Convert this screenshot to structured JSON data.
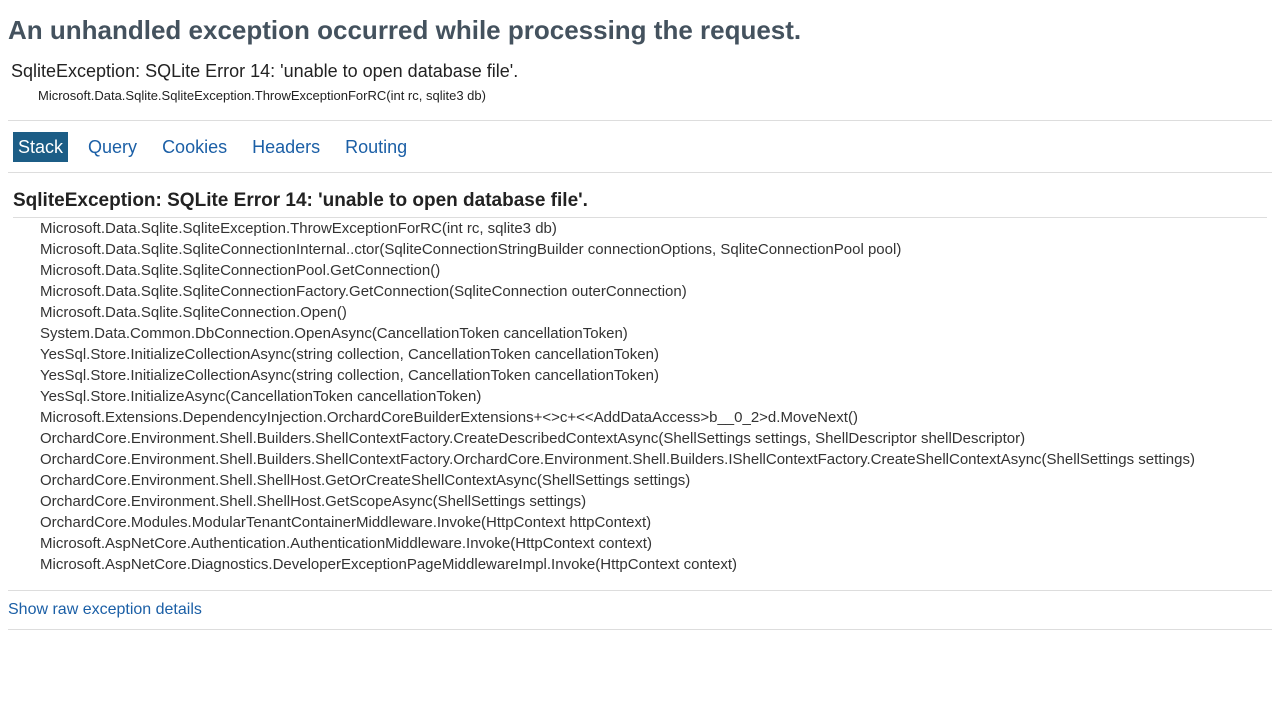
{
  "page": {
    "title": "An unhandled exception occurred while processing the request."
  },
  "summary": {
    "message": "SqliteException: SQLite Error 14: 'unable to open database file'.",
    "location": "Microsoft.Data.Sqlite.SqliteException.ThrowExceptionForRC(int rc, sqlite3 db)"
  },
  "tabs": [
    {
      "label": "Stack"
    },
    {
      "label": "Query"
    },
    {
      "label": "Cookies"
    },
    {
      "label": "Headers"
    },
    {
      "label": "Routing"
    }
  ],
  "stack": {
    "title": "SqliteException: SQLite Error 14: 'unable to open database file'.",
    "frames": [
      "Microsoft.Data.Sqlite.SqliteException.ThrowExceptionForRC(int rc, sqlite3 db)",
      "Microsoft.Data.Sqlite.SqliteConnectionInternal..ctor(SqliteConnectionStringBuilder connectionOptions, SqliteConnectionPool pool)",
      "Microsoft.Data.Sqlite.SqliteConnectionPool.GetConnection()",
      "Microsoft.Data.Sqlite.SqliteConnectionFactory.GetConnection(SqliteConnection outerConnection)",
      "Microsoft.Data.Sqlite.SqliteConnection.Open()",
      "System.Data.Common.DbConnection.OpenAsync(CancellationToken cancellationToken)",
      "YesSql.Store.InitializeCollectionAsync(string collection, CancellationToken cancellationToken)",
      "YesSql.Store.InitializeCollectionAsync(string collection, CancellationToken cancellationToken)",
      "YesSql.Store.InitializeAsync(CancellationToken cancellationToken)",
      "Microsoft.Extensions.DependencyInjection.OrchardCoreBuilderExtensions+<>c+<<AddDataAccess>b__0_2>d.MoveNext()",
      "OrchardCore.Environment.Shell.Builders.ShellContextFactory.CreateDescribedContextAsync(ShellSettings settings, ShellDescriptor shellDescriptor)",
      "OrchardCore.Environment.Shell.Builders.ShellContextFactory.OrchardCore.Environment.Shell.Builders.IShellContextFactory.CreateShellContextAsync(ShellSettings settings)",
      "OrchardCore.Environment.Shell.ShellHost.GetOrCreateShellContextAsync(ShellSettings settings)",
      "OrchardCore.Environment.Shell.ShellHost.GetScopeAsync(ShellSettings settings)",
      "OrchardCore.Modules.ModularTenantContainerMiddleware.Invoke(HttpContext httpContext)",
      "Microsoft.AspNetCore.Authentication.AuthenticationMiddleware.Invoke(HttpContext context)",
      "Microsoft.AspNetCore.Diagnostics.DeveloperExceptionPageMiddlewareImpl.Invoke(HttpContext context)"
    ]
  },
  "raw_link": "Show raw exception details",
  "colors": {
    "title": "#44525e",
    "link": "#1b5fa6",
    "selected_tab_bg": "#1c5d86",
    "separator": "#dddddd"
  }
}
